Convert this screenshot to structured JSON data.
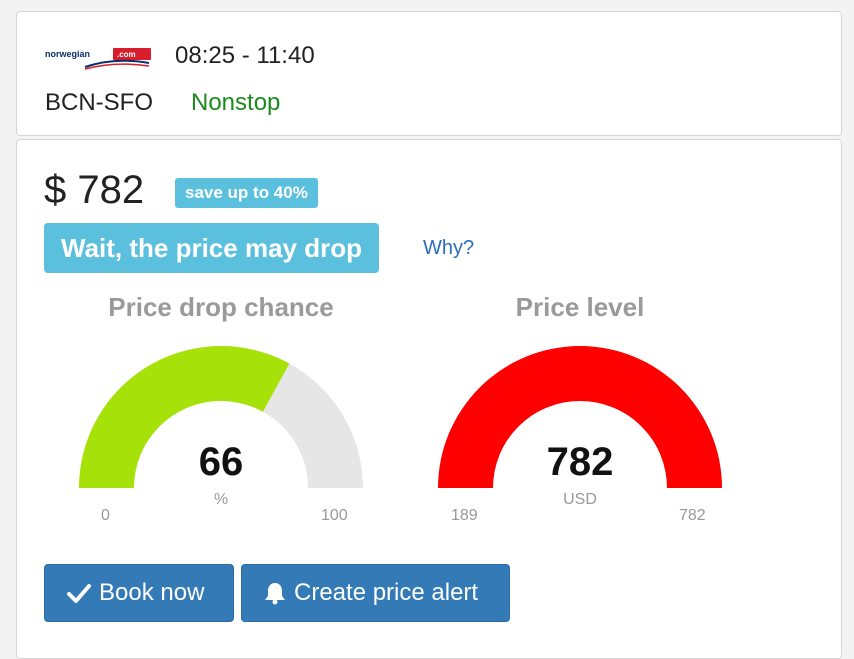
{
  "flight": {
    "airline_logo_text": "norwegian.com",
    "times": "08:25 - 11:40",
    "route": "BCN-SFO",
    "stops": "Nonstop"
  },
  "pricing": {
    "price": "$ 782",
    "save_badge": "save up to 40%",
    "advice": "Wait, the price may drop",
    "why_link": "Why?"
  },
  "gauges": {
    "drop_chance": {
      "title": "Price drop chance",
      "value": "66",
      "unit": "%",
      "min": "0",
      "max": "100",
      "fraction": 0.66,
      "fill_color": "#a6e10a",
      "track_color": "#e6e6e6"
    },
    "price_level": {
      "title": "Price level",
      "value": "782",
      "unit": "USD",
      "min": "189",
      "max": "782",
      "fraction": 1.0,
      "fill_color": "#ff0000",
      "track_color": "#e6e6e6"
    }
  },
  "actions": {
    "book_label": "Book now",
    "alert_label": "Create price alert"
  },
  "colors": {
    "accent": "#5bc0de",
    "button": "#337ab7",
    "nonstop": "#1e8a1e"
  }
}
